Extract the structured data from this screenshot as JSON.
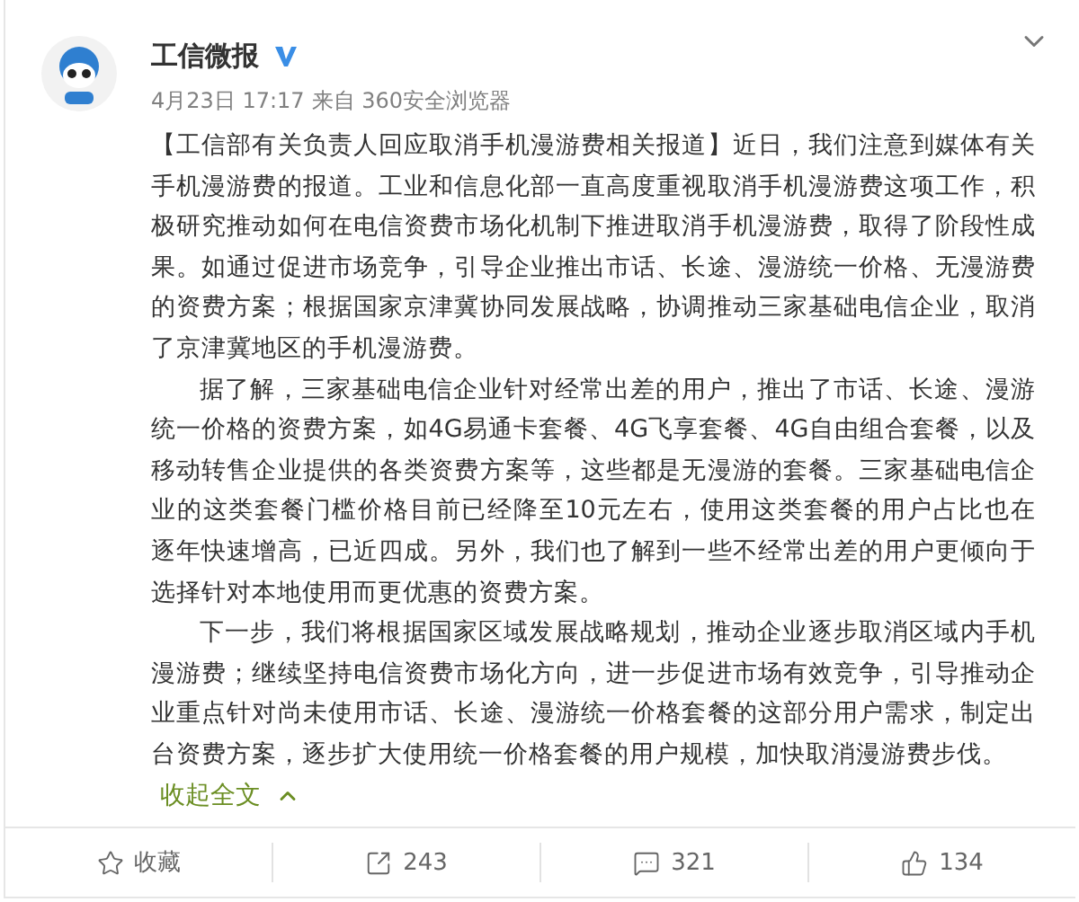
{
  "author": {
    "name": "工信微报",
    "verified": true
  },
  "meta": {
    "time": "4月23日 17:17",
    "source": "来自 360安全浏览器"
  },
  "paragraphs": [
    {
      "text": "【工信部有关负责人回应取消手机漫游费相关报道】近日，我们注意到媒体有关手机漫游费的报道。工业和信息化部一直高度重视取消手机漫游费这项工作，积极研究推动如何在电信资费市场化机制下推进取消手机漫游费，取得了阶段性成果。如通过促进市场竞争，引导企业推出市话、长途、漫游统一价格、无漫游费的资费方案；根据国家京津冀协同发展战略，协调推动三家基础电信企业，取消了京津冀地区的手机漫游费。",
      "indented": false
    },
    {
      "text": "据了解，三家基础电信企业针对经常出差的用户，推出了市话、长途、漫游统一价格的资费方案，如4G易通卡套餐、4G飞享套餐、4G自由组合套餐，以及移动转售企业提供的各类资费方案等，这些都是无漫游的套餐。三家基础电信企业的这类套餐门槛价格目前已经降至10元左右，使用这类套餐的用户占比也在逐年快速增高，已近四成。另外，我们也了解到一些不经常出差的用户更倾向于选择针对本地使用而更优惠的资费方案。",
      "indented": true
    },
    {
      "text": "下一步，我们将根据国家区域发展战略规划，推动企业逐步取消区域内手机漫游费；继续坚持电信资费市场化方向，进一步促进市场有效竞争，引导推动企业重点针对尚未使用市话、长途、漫游统一价格套餐的这部分用户需求，制定出台资费方案，逐步扩大使用统一价格套餐的用户规模，加快取消漫游费步伐。",
      "indented": true
    }
  ],
  "collapse_link": "收起全文",
  "actions": [
    {
      "kind": "favorite",
      "label": "收藏"
    },
    {
      "kind": "repost",
      "label": "243"
    },
    {
      "kind": "comment",
      "label": "321"
    },
    {
      "kind": "like",
      "label": "134"
    }
  ]
}
